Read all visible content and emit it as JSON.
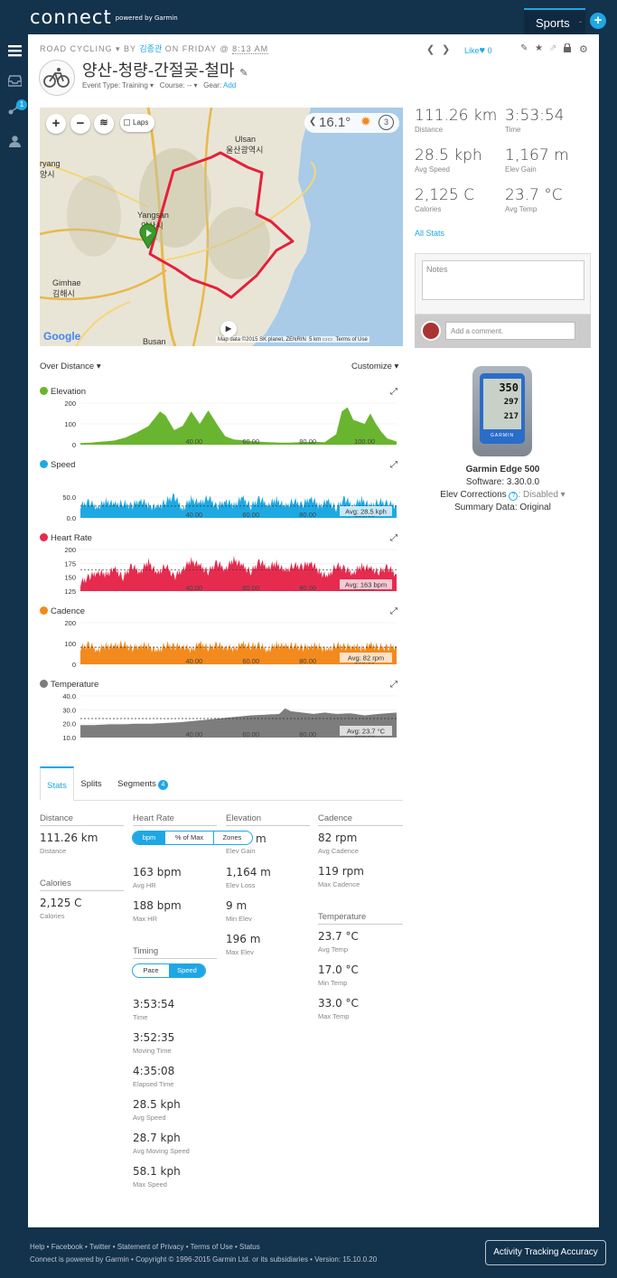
{
  "brand": {
    "logo": "connect",
    "powered": "powered by Garmin"
  },
  "topnav": {
    "sports_tab": "Sports",
    "sports_caret": "-",
    "plus": "+"
  },
  "sidebar": {
    "badge": "1"
  },
  "activity": {
    "type": "ROAD CYCLING",
    "by": "BY",
    "owner": "김종관",
    "on": "ON FRIDAY @",
    "time": "8:13 AM",
    "title": "양산-청량-간절곶-철마",
    "event_type": "Event Type: Training ▾",
    "course": "Course: -- ▾",
    "gear_label": "Gear:",
    "gear_add": "Add",
    "like": "Like",
    "like_count": "0"
  },
  "map": {
    "laps": "Laps",
    "temperature": "16.1°",
    "lap_count": "3",
    "labels": {
      "ulsan": "Ulsan",
      "ulsan_kr": "울산광역시",
      "yangsan": "Yangsan",
      "yangsan_kr": "양산시",
      "gimhae": "Gimhae",
      "gimhae_kr": "김해시",
      "busan": "Busan",
      "ryang": "ryang",
      "ryang_kr": "양시"
    },
    "google": "Google",
    "attribution": "Map data ©2015 SK planet, ZENRIN",
    "scale": "5 km",
    "terms": "Terms of Use"
  },
  "summary": [
    {
      "value": "111.26 km",
      "label": "Distance"
    },
    {
      "value": "3:53:54",
      "label": "Time"
    },
    {
      "value": "28.5 kph",
      "label": "Avg Speed"
    },
    {
      "value": "1,167 m",
      "label": "Elev Gain"
    },
    {
      "value": "2,125 C",
      "label": "Calories"
    },
    {
      "value": "23.7 °C",
      "label": "Avg Temp"
    }
  ],
  "all_stats": "All Stats",
  "notes_placeholder": "Notes",
  "comment_placeholder": "Add a comment.",
  "device": {
    "name": "Garmin Edge 500",
    "software": "Software: 3.30.0.0",
    "elev_label": "Elev Corrections",
    "elev_help": "?",
    "elev_value": ": Disabled ▾",
    "summary_data": "Summary Data: Original",
    "screen_a": "350",
    "screen_b": "297",
    "screen_c": "217",
    "brand": "GARMIN"
  },
  "charts_controls": {
    "over": "Over Distance ▾",
    "customize": "Customize ▾"
  },
  "chart_data": [
    {
      "type": "area",
      "title": "Elevation",
      "color": "#6ab52f",
      "ylim": [
        0,
        200
      ],
      "yticks": [
        "200",
        "100",
        "0"
      ],
      "xticks": [
        "40.00",
        "60.00",
        "80.00",
        "100.00"
      ],
      "xlim": [
        0,
        111.26
      ],
      "x": [
        0,
        4,
        8,
        12,
        16,
        20,
        24,
        28,
        30,
        33,
        36,
        39,
        42,
        45,
        48,
        51,
        54,
        58,
        62,
        66,
        70,
        74,
        78,
        82,
        86,
        90,
        92,
        94,
        96,
        98,
        100,
        102,
        104,
        106,
        108,
        111.26
      ],
      "y": [
        8,
        10,
        15,
        20,
        35,
        60,
        90,
        160,
        140,
        70,
        90,
        160,
        100,
        165,
        100,
        40,
        25,
        20,
        15,
        12,
        10,
        10,
        12,
        14,
        12,
        50,
        160,
        180,
        120,
        110,
        100,
        150,
        100,
        60,
        30,
        15
      ]
    },
    {
      "type": "area",
      "title": "Speed",
      "color": "#1fa9e3",
      "ylim": [
        0,
        100
      ],
      "yticks": [
        "50.0",
        "0.0"
      ],
      "xticks": [
        "40.00",
        "60.00",
        "80.00",
        "100.00"
      ],
      "xlim": [
        0,
        111.26
      ],
      "avg_label": "Avg: 28.5 kph",
      "avg": 28.5,
      "x": [
        0,
        3,
        6,
        9,
        12,
        15,
        18,
        21,
        24,
        27,
        30,
        33,
        36,
        39,
        42,
        45,
        48,
        51,
        54,
        57,
        60,
        63,
        66,
        69,
        72,
        75,
        78,
        81,
        84,
        87,
        90,
        93,
        96,
        99,
        102,
        105,
        108,
        111.26
      ],
      "y": [
        30,
        38,
        26,
        40,
        32,
        36,
        28,
        44,
        30,
        24,
        40,
        52,
        22,
        46,
        34,
        50,
        26,
        42,
        30,
        48,
        28,
        46,
        32,
        44,
        26,
        42,
        30,
        50,
        28,
        40,
        24,
        46,
        30,
        44,
        28,
        40,
        34,
        30
      ]
    },
    {
      "type": "area",
      "title": "Heart Rate",
      "color": "#e62b4e",
      "ylim": [
        125,
        200
      ],
      "yticks": [
        "200",
        "175",
        "150",
        "125"
      ],
      "xticks": [
        "40.00",
        "60.00",
        "80.00",
        "100.00"
      ],
      "xlim": [
        0,
        111.26
      ],
      "avg_label": "Avg: 163 bpm",
      "avg": 163,
      "x": [
        0,
        3,
        6,
        9,
        12,
        15,
        18,
        21,
        24,
        27,
        30,
        33,
        36,
        39,
        42,
        45,
        48,
        51,
        54,
        57,
        60,
        63,
        66,
        69,
        72,
        75,
        78,
        81,
        84,
        87,
        90,
        93,
        96,
        99,
        102,
        105,
        108,
        111.26
      ],
      "y": [
        140,
        150,
        160,
        155,
        165,
        150,
        170,
        160,
        178,
        155,
        172,
        150,
        165,
        180,
        170,
        160,
        176,
        165,
        182,
        170,
        160,
        178,
        168,
        175,
        160,
        172,
        168,
        178,
        160,
        150,
        172,
        165,
        158,
        170,
        165,
        160,
        168,
        155
      ]
    },
    {
      "type": "area",
      "title": "Cadence",
      "color": "#f28a1d",
      "ylim": [
        0,
        200
      ],
      "yticks": [
        "200",
        "100",
        "0"
      ],
      "xticks": [
        "40.00",
        "60.00",
        "80.00",
        "100.00"
      ],
      "xlim": [
        0,
        111.26
      ],
      "avg_label": "Avg: 82 rpm",
      "avg": 82,
      "x": [
        0,
        3,
        6,
        9,
        12,
        15,
        18,
        21,
        24,
        27,
        30,
        33,
        36,
        39,
        42,
        45,
        48,
        51,
        54,
        57,
        60,
        63,
        66,
        69,
        72,
        75,
        78,
        81,
        84,
        87,
        90,
        93,
        96,
        99,
        102,
        105,
        108,
        111.26
      ],
      "y": [
        80,
        95,
        70,
        90,
        85,
        100,
        75,
        92,
        88,
        60,
        95,
        85,
        90,
        70,
        98,
        80,
        92,
        85,
        75,
        95,
        88,
        90,
        70,
        96,
        84,
        92,
        78,
        90,
        86,
        65,
        95,
        82,
        90,
        76,
        92,
        85,
        80,
        88
      ]
    },
    {
      "type": "area",
      "title": "Temperature",
      "color": "#7d7d7d",
      "ylim": [
        10,
        40
      ],
      "yticks": [
        "40.0",
        "30.0",
        "20.0",
        "10.0"
      ],
      "xticks": [
        "40.00",
        "60.00",
        "80.00",
        "100.00"
      ],
      "xlim": [
        0,
        111.26
      ],
      "avg_label": "Avg: 23.7 °C",
      "avg": 23.7,
      "x": [
        0,
        5,
        10,
        15,
        20,
        25,
        30,
        35,
        40,
        45,
        50,
        55,
        60,
        65,
        70,
        72,
        74,
        78,
        82,
        86,
        90,
        95,
        100,
        105,
        111.26
      ],
      "y": [
        19,
        19,
        19.5,
        19.5,
        20,
        20,
        20.5,
        21,
        22,
        23,
        24,
        25,
        26,
        26.5,
        27,
        31,
        29,
        28,
        27,
        28,
        27,
        27.5,
        26,
        27,
        28
      ]
    }
  ],
  "tabs": {
    "stats": "Stats",
    "splits": "Splits",
    "segments": "Segments",
    "segments_count": "4"
  },
  "stats": {
    "distance_h": "Distance",
    "distance_v": "111.26 km",
    "distance_l": "Distance",
    "calories_h": "Calories",
    "calories_v": "2,125 C",
    "calories_l": "Calories",
    "hr_h": "Heart Rate",
    "hr_toggle": [
      "bpm",
      "% of Max",
      "Zones"
    ],
    "avg_hr_v": "163 bpm",
    "avg_hr_l": "Avg HR",
    "max_hr_v": "188 bpm",
    "max_hr_l": "Max HR",
    "timing_h": "Timing",
    "timing_toggle": [
      "Pace",
      "Speed"
    ],
    "time_v": "3:53:54",
    "time_l": "Time",
    "moving_v": "3:52:35",
    "moving_l": "Moving Time",
    "elapsed_v": "4:35:08",
    "elapsed_l": "Elapsed Time",
    "avgspd_v": "28.5 kph",
    "avgspd_l": "Avg Speed",
    "avgmov_v": "28.7 kph",
    "avgmov_l": "Avg Moving Speed",
    "maxspd_v": "58.1 kph",
    "maxspd_l": "Max Speed",
    "elev_h": "Elevation",
    "elev_gain_v": "m",
    "elev_gain_l": "Elev Gain",
    "elev_loss_v": "1,164 m",
    "elev_loss_l": "Elev Loss",
    "min_elev_v": "9 m",
    "min_elev_l": "Min Elev",
    "max_elev_v": "196 m",
    "max_elev_l": "Max Elev",
    "cad_h": "Cadence",
    "avg_cad_v": "82 rpm",
    "avg_cad_l": "Avg Cadence",
    "max_cad_v": "119 rpm",
    "max_cad_l": "Max Cadence",
    "temp_h": "Temperature",
    "avg_temp_v": "23.7 °C",
    "avg_temp_l": "Avg Temp",
    "min_temp_v": "17.0 °C",
    "min_temp_l": "Min Temp",
    "max_temp_v": "33.0 °C",
    "max_temp_l": "Max Temp"
  },
  "footer": {
    "links": "Help • Facebook • Twitter • Statement of Privacy • Terms of Use • Status",
    "copyright": "Connect is powered by Garmin • Copyright © 1996-2015 Garmin Ltd. or its subsidiaries • Version: 15.10.0.20",
    "button": "Activity Tracking Accuracy"
  }
}
